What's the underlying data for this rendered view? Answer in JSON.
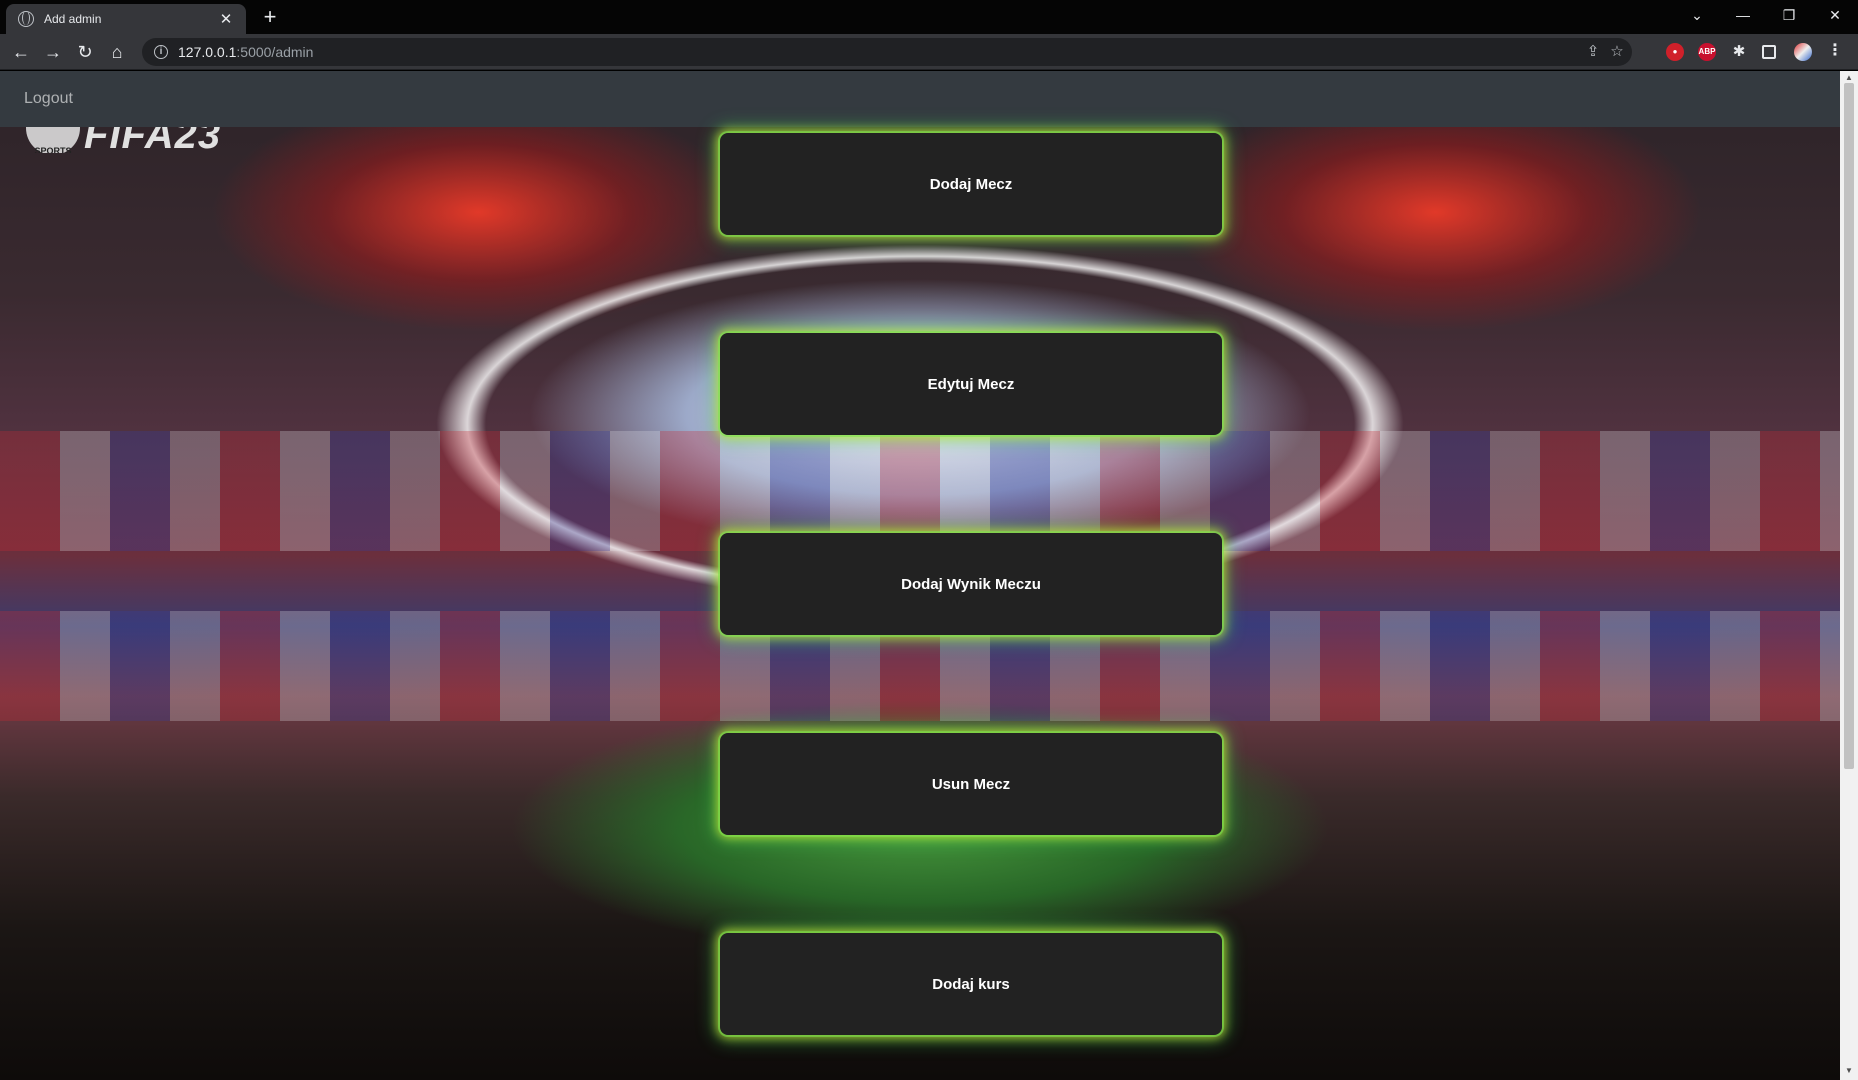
{
  "browser": {
    "tab_title": "Add admin",
    "tab_close": "✕",
    "new_tab": "+",
    "url_host": "127.0.0.1",
    "url_path": ":5000/admin",
    "window_controls": {
      "dropdown": "⌄",
      "minimize": "—",
      "restore": "❐",
      "close": "✕"
    },
    "nav": {
      "back": "←",
      "forward": "→",
      "reload": "↻",
      "home": "⌂"
    },
    "extensions": [
      "adblock-shield-icon",
      "abp-icon",
      "puzzle-icon",
      "sidebar-icon",
      "profile-avatar",
      "kebab-menu-icon"
    ],
    "ext_abp_label": "ABP"
  },
  "navbar": {
    "logout_label": "Logout"
  },
  "logo": {
    "badge_text": "SPORTS",
    "word_text": "FIFA23"
  },
  "menu": {
    "items": [
      {
        "label": "Dodaj Mecz"
      },
      {
        "label": "Edytuj Mecz"
      },
      {
        "label": "Dodaj Wynik Meczu"
      },
      {
        "label": "Usun Mecz"
      },
      {
        "label": "Dodaj kurs"
      }
    ]
  },
  "colors": {
    "navbar_bg": "#343a40",
    "button_bg": "#222222",
    "button_glow": "#8fe04a"
  }
}
